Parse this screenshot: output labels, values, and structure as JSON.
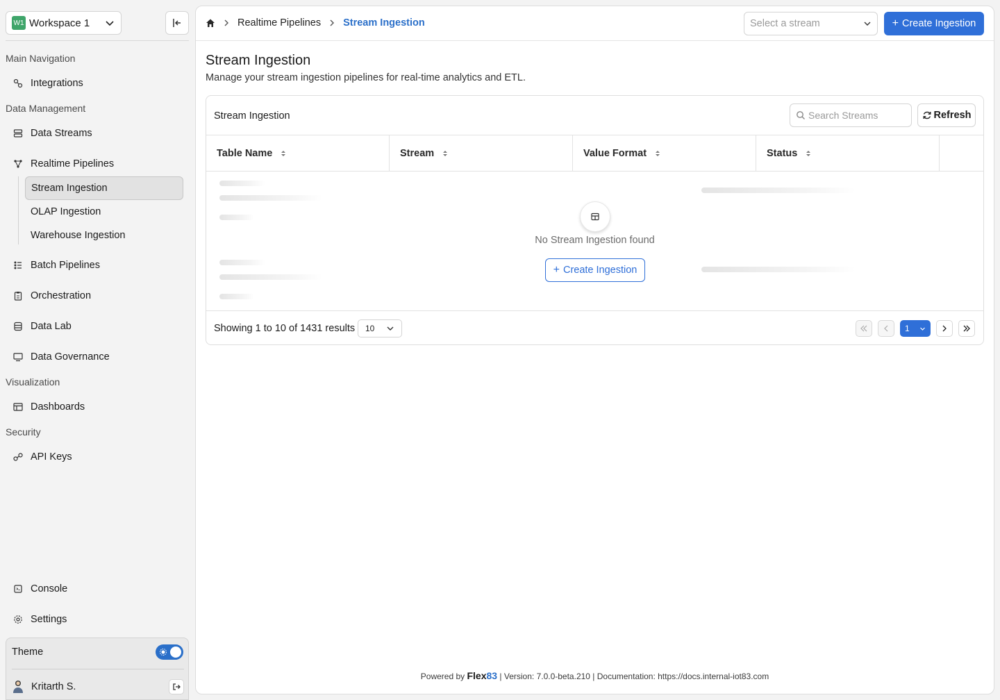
{
  "workspace": {
    "badge": "W1",
    "name": "Workspace 1"
  },
  "sidebar": {
    "sections": {
      "main_navigation": "Main Navigation",
      "data_management": "Data Management",
      "visualization": "Visualization",
      "security": "Security"
    },
    "items": {
      "integrations": "Integrations",
      "data_streams": "Data Streams",
      "realtime_pipelines": "Realtime Pipelines",
      "stream_ingestion": "Stream Ingestion",
      "olap_ingestion": "OLAP Ingestion",
      "warehouse_ingestion": "Warehouse Ingestion",
      "batch_pipelines": "Batch Pipelines",
      "orchestration": "Orchestration",
      "data_lab": "Data Lab",
      "data_governance": "Data Governance",
      "dashboards": "Dashboards",
      "api_keys": "API Keys",
      "console": "Console",
      "settings": "Settings"
    },
    "theme_label": "Theme",
    "user_name": "Kritarth S."
  },
  "breadcrumb": {
    "parent": "Realtime Pipelines",
    "current": "Stream Ingestion"
  },
  "header": {
    "stream_select_placeholder": "Select a stream",
    "create_label": "Create Ingestion"
  },
  "page": {
    "title": "Stream Ingestion",
    "description": "Manage your stream ingestion pipelines for real-time analytics and ETL."
  },
  "table": {
    "card_title": "Stream Ingestion",
    "search_placeholder": "Search Streams",
    "refresh_label": "Refresh",
    "columns": [
      "Table Name",
      "Stream",
      "Value Format",
      "Status"
    ],
    "empty_text": "No Stream Ingestion found",
    "empty_button": "Create Ingestion"
  },
  "pagination": {
    "showing": "Showing 1 to 10 of 1431 results",
    "page_size": "10",
    "current_page": "1"
  },
  "footer": {
    "powered_by": "Powered by",
    "brand": "Flex",
    "brand_num": "83",
    "version": "| Version: 7.0.0-beta.210 | Documentation: https://docs.internal-iot83.com"
  },
  "colors": {
    "accent": "#2f6fd8",
    "badge": "#3fa56a",
    "active_bg": "#e2e2e2"
  }
}
